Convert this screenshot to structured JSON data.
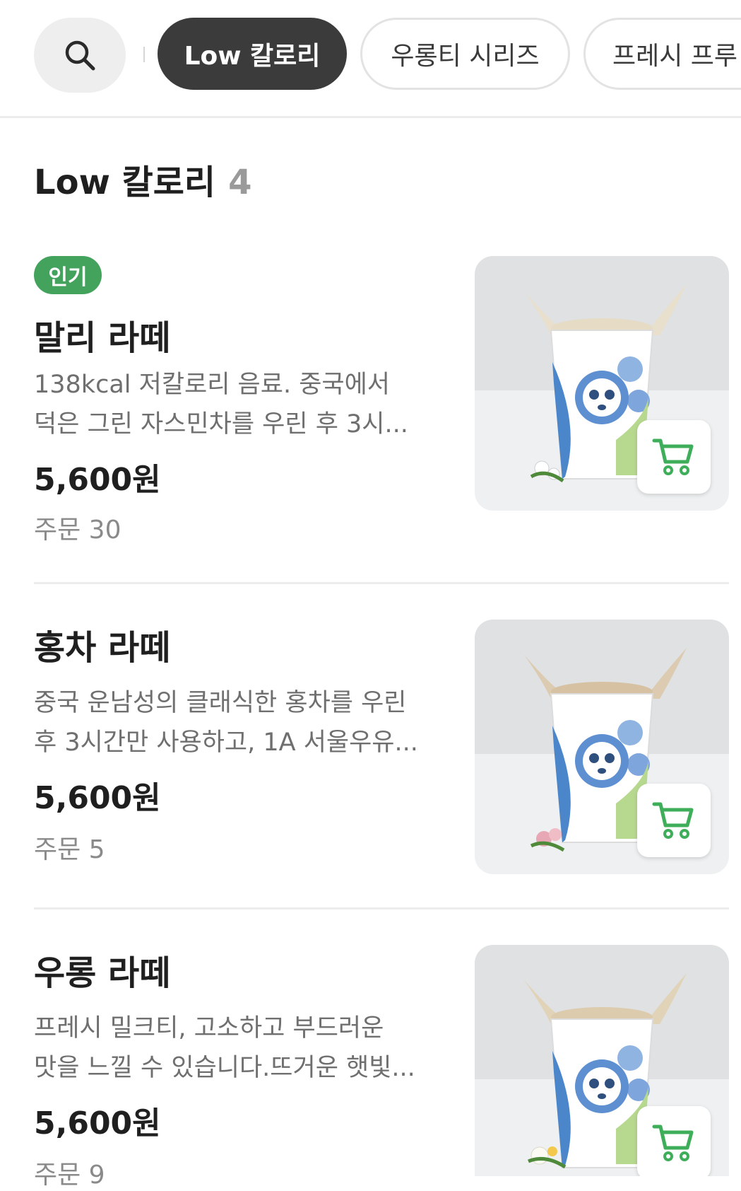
{
  "header": {
    "search_icon": "search-icon",
    "categories": [
      {
        "label": "Low 칼로리",
        "active": true
      },
      {
        "label": "우롱티 시리즈",
        "active": false
      },
      {
        "label": "프레시 프루",
        "active": false
      }
    ]
  },
  "section": {
    "title": "Low 칼로리",
    "count": "4"
  },
  "items": [
    {
      "badge": "인기",
      "name": "말리 라떼",
      "desc_line1": "138kcal 저칼로리 음료. 중국에서",
      "desc_line2": "덕은 그린 자스민차를 우린 후 3시...",
      "price": "5,600원",
      "orders": "주문 30",
      "image": "jasmine-milk-tea-cup-image",
      "cart_icon": "cart-icon"
    },
    {
      "name": "홍차 라떼",
      "desc_line1": "중국 운남성의 클래식한 홍차를 우린",
      "desc_line2": "후 3시간만 사용하고, 1A 서울우유...",
      "price": "5,600원",
      "orders": "주문 5",
      "image": "black-tea-latte-cup-image",
      "cart_icon": "cart-icon"
    },
    {
      "name": "우롱 라떼",
      "desc_line1": "프레시 밀크티, 고소하고 부드러운",
      "desc_line2": "맛을 느낄 수 있습니다.뜨거운 햇빛...",
      "price": "5,600원",
      "orders": "주문 9",
      "image": "oolong-latte-cup-image",
      "cart_icon": "cart-icon"
    }
  ],
  "colors": {
    "badge_green": "#43a35c",
    "cart_green": "#3fae5a",
    "active_chip": "#3b3b3b"
  }
}
